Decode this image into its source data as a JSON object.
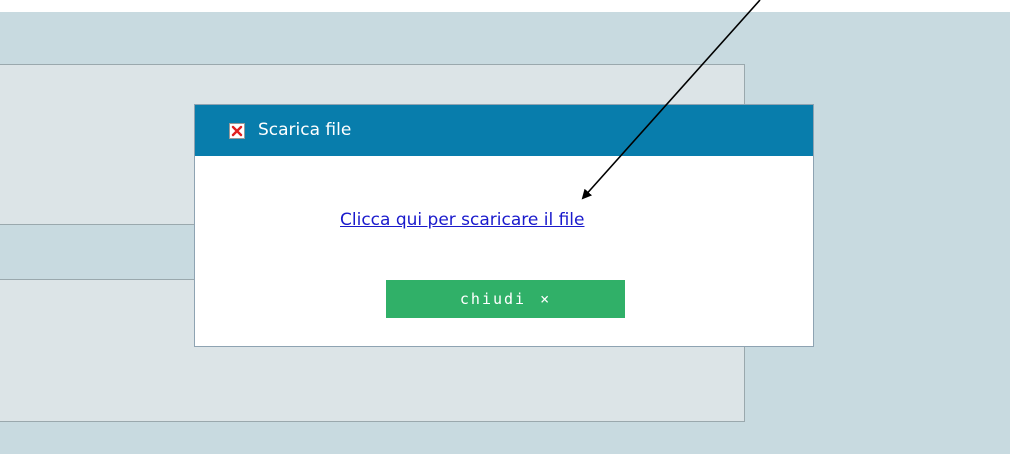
{
  "dialog": {
    "title": "Scarica file",
    "close_icon": "close-x-icon",
    "link_text": "Clicca qui per scaricare il file",
    "close_button_label": "chiudi",
    "close_button_symbol": "×"
  },
  "colors": {
    "header": "#087dac",
    "button": "#30b068",
    "link": "#1a1acc",
    "page_bg": "#c8dae0",
    "panel_bg": "#dce4e7",
    "close_icon_red": "#e02020"
  }
}
